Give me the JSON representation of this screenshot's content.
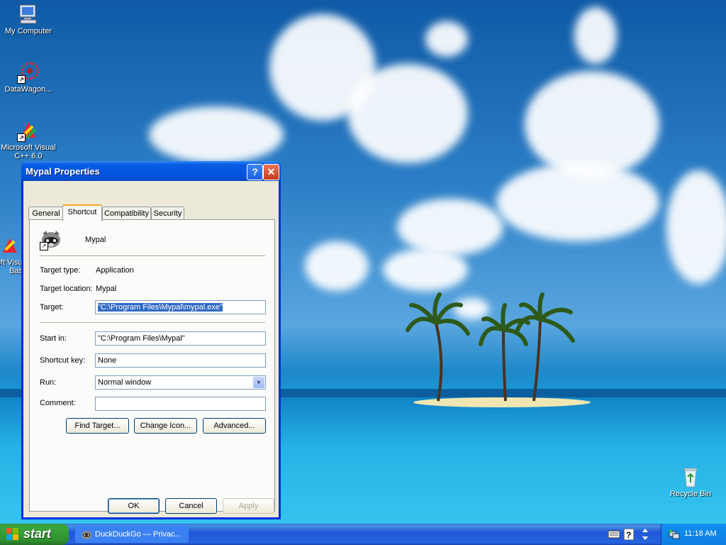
{
  "desktop": {
    "icons": [
      {
        "label": "My Computer"
      },
      {
        "label": "DataWagon..."
      },
      {
        "label": "Microsoft Visual C++ 6.0"
      },
      {
        "label": "Microsoft Visual Basic"
      },
      {
        "label": "Recycle Bin"
      }
    ]
  },
  "dialog": {
    "title": "Mypal Properties",
    "help_glyph": "?",
    "close_glyph": "✕",
    "tabs": [
      {
        "label": "General"
      },
      {
        "label": "Shortcut"
      },
      {
        "label": "Compatibility"
      },
      {
        "label": "Security"
      }
    ],
    "active_tab": "Shortcut",
    "app_name": "Mypal",
    "target_type_label": "Target type:",
    "target_type_value": "Application",
    "target_location_label": "Target location:",
    "target_location_value": "Mypal",
    "target_label": "Target:",
    "target_value": "\"C:\\Program Files\\Mypal\\mypal.exe\"",
    "start_in_label": "Start in:",
    "start_in_value": "\"C:\\Program Files\\Mypal\"",
    "shortcut_key_label": "Shortcut key:",
    "shortcut_key_value": "None",
    "run_label": "Run:",
    "run_value": "Normal window",
    "comment_label": "Comment:",
    "comment_value": "",
    "find_target_label": "Find Target...",
    "change_icon_label": "Change Icon...",
    "advanced_label": "Advanced...",
    "ok_label": "OK",
    "cancel_label": "Cancel",
    "apply_label": "Apply"
  },
  "taskbar": {
    "start_label": "start",
    "tasks": [
      {
        "label": "DuckDuckGo — Privac..."
      }
    ],
    "clock": "11:18 AM"
  },
  "colors": {
    "titlebar": "#0454e0",
    "taskbar": "#2157d7",
    "start_button": "#3aa63a",
    "dialog_face": "#ece9d8"
  }
}
